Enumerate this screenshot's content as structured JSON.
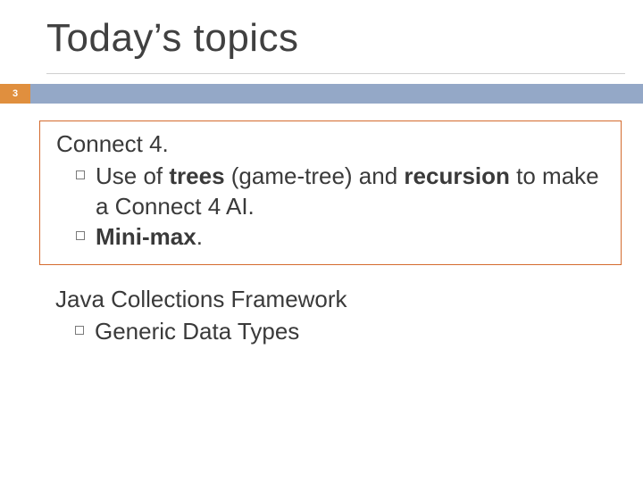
{
  "slide": {
    "title": "Today’s topics",
    "page_number": "3",
    "section1": {
      "heading": "Connect 4.",
      "items": [
        {
          "pre": "Use of ",
          "b1": "trees",
          "mid": " (game-tree) and ",
          "b2": "recursion",
          "post": " to make a Connect 4 AI."
        },
        {
          "b1": "Mini-max",
          "post": "."
        }
      ]
    },
    "section2": {
      "heading": "Java Collections Framework",
      "items": [
        {
          "text": "Generic Data Types"
        }
      ]
    }
  }
}
